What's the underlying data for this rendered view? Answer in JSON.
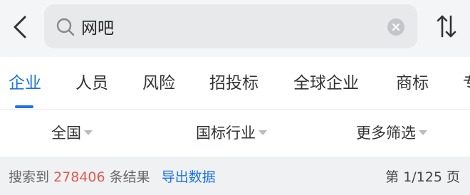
{
  "header": {
    "back_icon": "chevron-left-icon",
    "search": {
      "value": "网吧",
      "placeholder": ""
    },
    "clear_icon": "clear-circle-icon",
    "sort_icon": "sort-arrows-icon"
  },
  "tabs": [
    {
      "label": "企业",
      "active": true
    },
    {
      "label": "人员",
      "active": false
    },
    {
      "label": "风险",
      "active": false
    },
    {
      "label": "招投标",
      "active": false
    },
    {
      "label": "全球企业",
      "active": false
    },
    {
      "label": "商标",
      "active": false
    },
    {
      "label": "专",
      "active": false
    }
  ],
  "filters": [
    {
      "label": "全国"
    },
    {
      "label": "国标行业"
    },
    {
      "label": "更多筛选"
    }
  ],
  "results": {
    "prefix": "搜索到",
    "count": "278406",
    "suffix": "条结果",
    "export_label": "导出数据",
    "pager": "第 1/125 页"
  },
  "colors": {
    "accent": "#1a73e8",
    "count": "#e05a4f"
  }
}
